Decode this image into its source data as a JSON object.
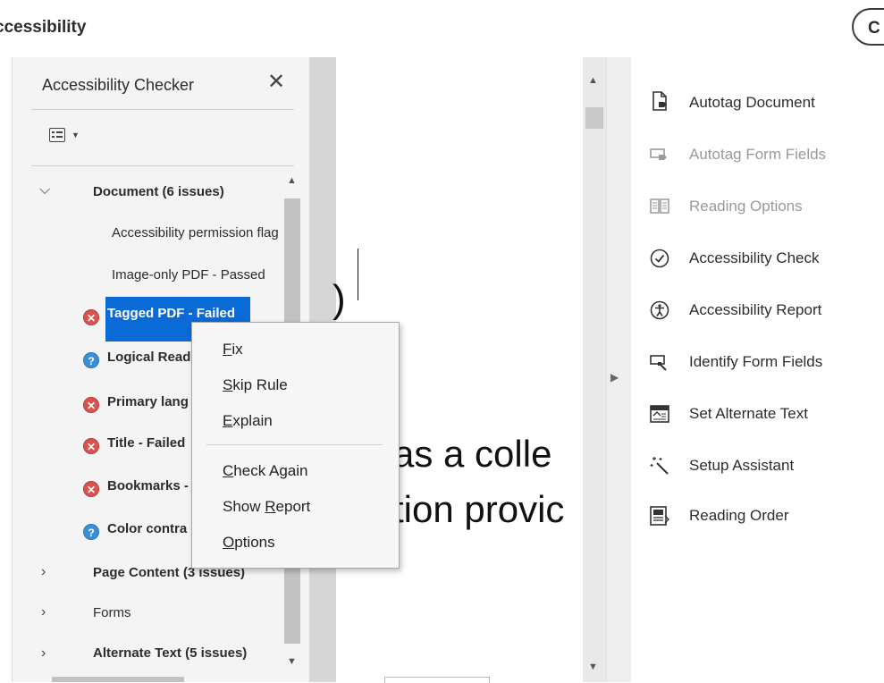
{
  "top": {
    "title": "ccessibility",
    "button_label": "C"
  },
  "checker": {
    "title": "Accessibility Checker",
    "close_label": "✕",
    "tree": [
      {
        "label": "Document (6 issues)",
        "expanded": true,
        "bold": true
      },
      {
        "label": "Accessibility permission flag",
        "status": "none"
      },
      {
        "label": "Image-only PDF - Passed",
        "status": "none"
      },
      {
        "label": "Tagged PDF - Failed",
        "status": "failed",
        "selected": true
      },
      {
        "label": "Logical Read",
        "status": "help"
      },
      {
        "label": "Primary lang",
        "status": "failed"
      },
      {
        "label": "Title - Failed",
        "status": "failed"
      },
      {
        "label": "Bookmarks -",
        "status": "failed"
      },
      {
        "label": "Color contra",
        "status": "help"
      },
      {
        "label": "Page Content (3 issues)",
        "expanded": false,
        "bold": true
      },
      {
        "label": "Forms",
        "expanded": false,
        "bold": false
      },
      {
        "label": "Alternate Text (5 issues)",
        "expanded": false,
        "bold": true
      }
    ]
  },
  "context_menu": {
    "items": [
      {
        "label_pre": "",
        "mnemonic": "F",
        "label_post": "ix"
      },
      {
        "label_pre": "",
        "mnemonic": "S",
        "label_post": "kip Rule"
      },
      {
        "label_pre": "",
        "mnemonic": "E",
        "label_post": "xplain"
      },
      {
        "label_pre": "",
        "mnemonic": "C",
        "label_post": "heck Again"
      },
      {
        "label_pre": "Show ",
        "mnemonic": "R",
        "label_post": "eport"
      },
      {
        "label_pre": "",
        "mnemonic": "O",
        "label_post": "ptions"
      }
    ]
  },
  "document": {
    "line1": "as a colle",
    "line2": "tion provic",
    "partial_char": ")"
  },
  "tools": [
    {
      "label": "Autotag Document",
      "icon": "autotag-document-icon",
      "enabled": true
    },
    {
      "label": "Autotag Form Fields",
      "icon": "autotag-form-fields-icon",
      "enabled": false
    },
    {
      "label": "Reading Options",
      "icon": "reading-options-icon",
      "enabled": false
    },
    {
      "label": "Accessibility Check",
      "icon": "checkmark-circle-icon",
      "enabled": true
    },
    {
      "label": "Accessibility Report",
      "icon": "accessibility-person-icon",
      "enabled": true
    },
    {
      "label": "Identify Form Fields",
      "icon": "identify-form-fields-icon",
      "enabled": true
    },
    {
      "label": "Set Alternate Text",
      "icon": "image-alt-text-icon",
      "enabled": true
    },
    {
      "label": "Setup Assistant",
      "icon": "magic-wand-icon",
      "enabled": true
    },
    {
      "label": "Reading Order",
      "icon": "reading-order-icon",
      "enabled": true
    }
  ],
  "colors": {
    "selection": "#0a6ad6",
    "failed": "#d9534f",
    "help": "#3b8fd6",
    "disabled_text": "#9a9a9a"
  }
}
